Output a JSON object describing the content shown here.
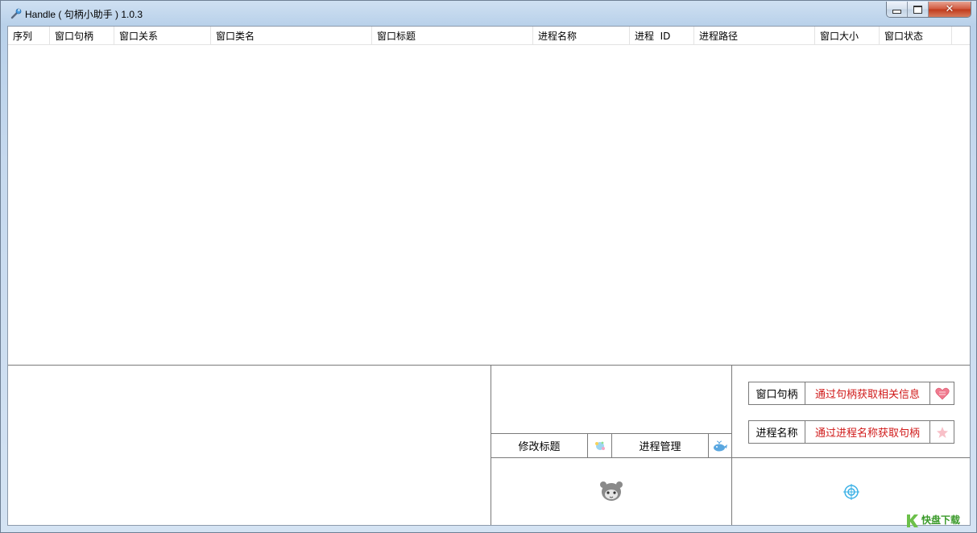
{
  "window": {
    "title": "Handle ( 句柄小助手 ) 1.0.3"
  },
  "list": {
    "columns": [
      "序列",
      "窗口句柄",
      "窗口关系",
      "窗口类名",
      "窗口标题",
      "进程名称",
      "进程  ID",
      "进程路径",
      "窗口大小",
      "窗口状态"
    ],
    "rows": []
  },
  "mid_panel": {
    "rename_title_label": "修改标题",
    "process_manage_label": "进程管理"
  },
  "right_panel": {
    "handle_label": "窗口句柄",
    "handle_action": "通过句柄获取相关信息",
    "process_label": "进程名称",
    "process_action": "通过进程名称获取句柄"
  },
  "watermark": {
    "text": "快盘下载"
  },
  "colors": {
    "action_text": "#d01a1a",
    "window_frame": "#b9d1ea",
    "close_button": "#c0391c"
  },
  "icons": {
    "app": "wrench-icon",
    "rename": "sparkle-icon",
    "process": "whale-icon",
    "handle": "heart-icon",
    "process_name": "star-icon",
    "mascot": "mascot-icon",
    "target": "crosshair-icon"
  }
}
